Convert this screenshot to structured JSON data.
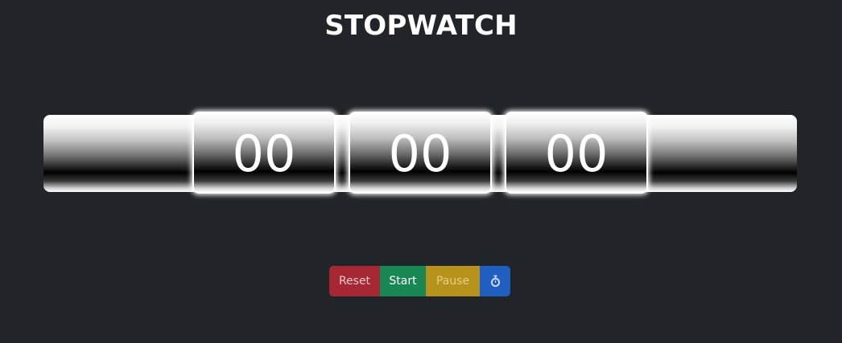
{
  "header": {
    "title": "STOPWATCH"
  },
  "display": {
    "hours": "00",
    "minutes": "00",
    "seconds": "00"
  },
  "controls": {
    "reset_label": "Reset",
    "start_label": "Start",
    "pause_label": "Pause",
    "lap_icon": "stopwatch-icon"
  },
  "colors": {
    "background": "#212529",
    "reset": "#a52834",
    "start": "#198754",
    "pause": "#b8931c",
    "lap": "#1f5fbf"
  }
}
